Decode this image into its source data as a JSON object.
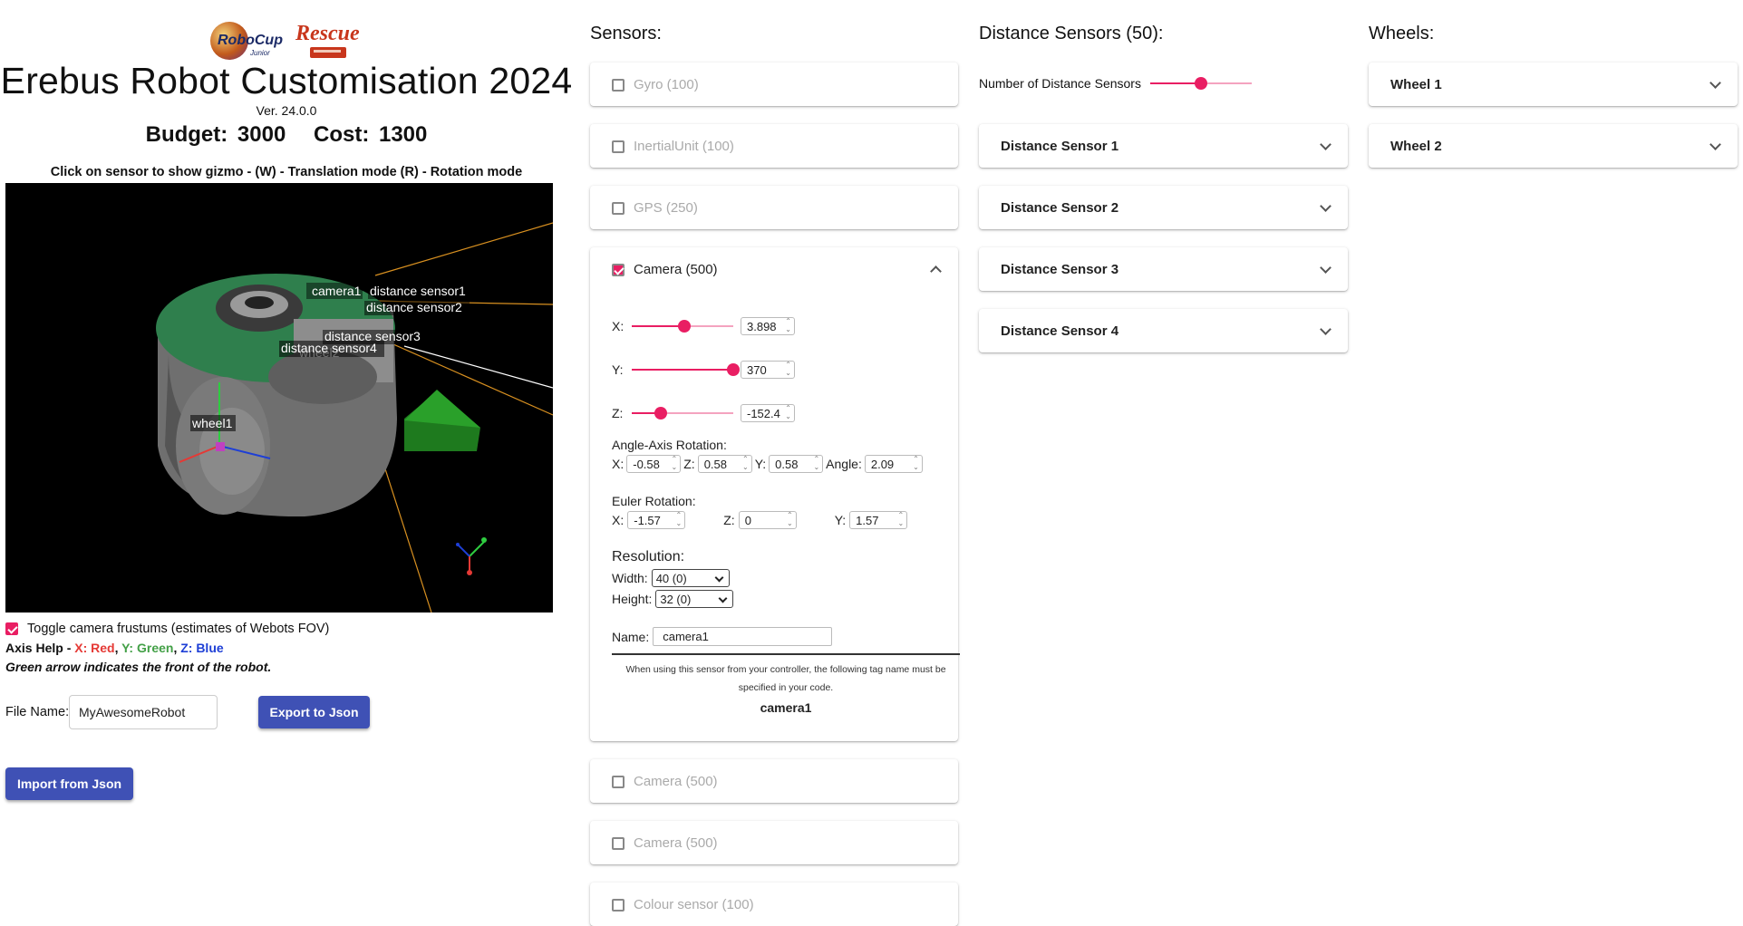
{
  "header": {
    "logo_robocup": "RoboCup",
    "logo_junior": "Junior",
    "logo_rescue": "Rescue",
    "title": "Erebus Robot Customisation 2024",
    "version": "Ver. 24.0.0",
    "budget": "Budget: 3000",
    "cost": "Cost: 1300",
    "help": "Click on sensor to show gizmo - (W) - Translation mode (R) - Rotation mode"
  },
  "viewport": {
    "labels": {
      "camera1": "camera1",
      "ds1": "distance sensor1",
      "ds2": "distance sensor2",
      "ds3": "distance sensor3",
      "ds4": "distance sensor4",
      "wheel1": "wheel1",
      "wheel2_partial": "wheel2"
    }
  },
  "left": {
    "frustum_toggle_label": "Toggle camera frustums (estimates of Webots FOV)",
    "frustum_checked": true,
    "axis_help_prefix": "Axis Help - ",
    "axis_x": "X: Red",
    "axis_y": "Y: Green",
    "axis_z": "Z: Blue",
    "green_note": "Green arrow indicates the front of the robot.",
    "file_name_label": "File Name:",
    "file_name_value": "MyAwesomeRobot",
    "export_label": "Export to Json",
    "import_label": "Import from Json"
  },
  "sensors": {
    "title": "Sensors:",
    "items": [
      {
        "label": "Gyro (100)",
        "checked": false
      },
      {
        "label": "InertialUnit (100)",
        "checked": false
      },
      {
        "label": "GPS (250)",
        "checked": false
      },
      {
        "label": "Camera (500)",
        "checked": true
      },
      {
        "label": "Camera (500)",
        "checked": false
      },
      {
        "label": "Camera (500)",
        "checked": false
      },
      {
        "label": "Colour sensor (100)",
        "checked": false
      }
    ],
    "camera": {
      "x_label": "X:",
      "x_value": "3.898",
      "x_fraction": 0.52,
      "y_label": "Y:",
      "y_value": "370",
      "y_fraction": 1.0,
      "z_label": "Z:",
      "z_value": "-152.4",
      "z_fraction": 0.29,
      "angle_axis_title": "Angle-Axis Rotation:",
      "aa_x_label": "X:",
      "aa_x": "-0.58",
      "aa_z_label": "Z:",
      "aa_z": "0.58",
      "aa_y_label": "Y:",
      "aa_y": "0.58",
      "aa_angle_label": "Angle:",
      "aa_angle": "2.09",
      "euler_title": "Euler Rotation:",
      "eu_x_label": "X:",
      "eu_x": "-1.57",
      "eu_z_label": "Z:",
      "eu_z": "0",
      "eu_y_label": "Y:",
      "eu_y": "1.57",
      "resolution_title": "Resolution:",
      "width_label": "Width:",
      "width_value": "40 (0)",
      "height_label": "Height:",
      "height_value": "32 (0)",
      "name_label": "Name:",
      "name_value": "camera1",
      "tag_note": "When using this sensor from your controller, the following tag name must be specified in your code.",
      "tag_name": "camera1"
    }
  },
  "distance": {
    "title": "Distance Sensors (50):",
    "count_label": "Number of Distance Sensors",
    "count_fraction": 0.5,
    "items": [
      "Distance Sensor 1",
      "Distance Sensor 2",
      "Distance Sensor 3",
      "Distance Sensor 4"
    ]
  },
  "wheels": {
    "title": "Wheels:",
    "items": [
      "Wheel 1",
      "Wheel 2"
    ]
  },
  "colors": {
    "accent": "#e91e63",
    "button": "#3f51b5",
    "axis_x": "#e53935",
    "axis_y": "#43a047",
    "axis_z": "#1e3fd6"
  }
}
